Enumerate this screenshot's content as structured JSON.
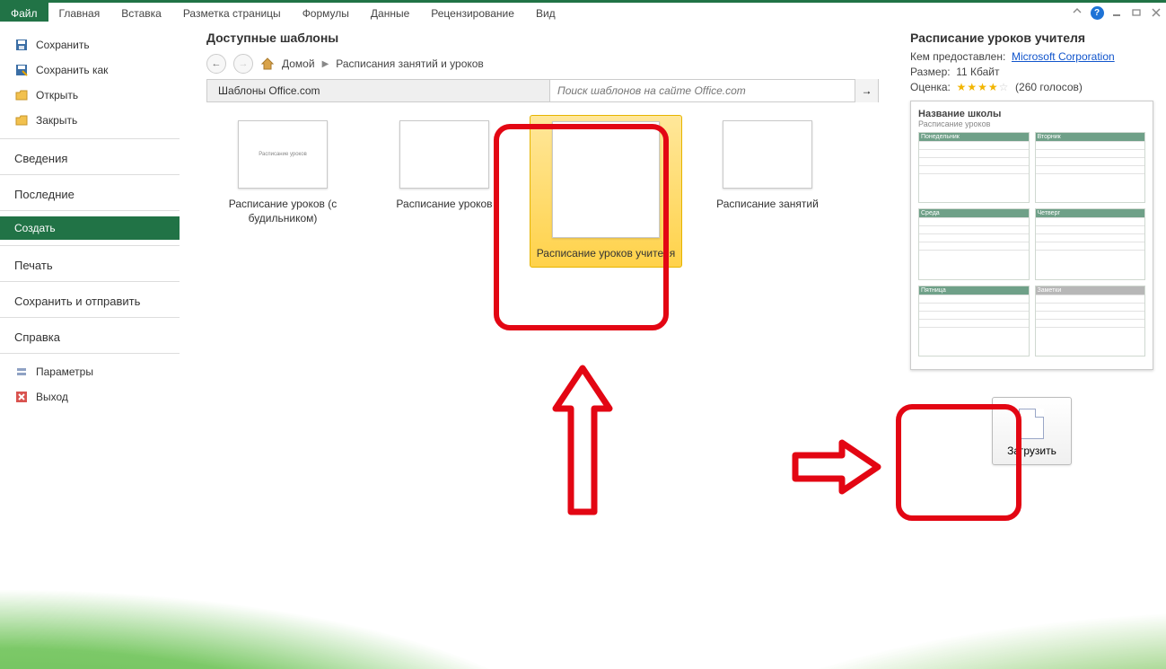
{
  "ribbon": {
    "tabs": [
      "Файл",
      "Главная",
      "Вставка",
      "Разметка страницы",
      "Формулы",
      "Данные",
      "Рецензирование",
      "Вид"
    ],
    "active_index": 0
  },
  "sidebar": {
    "items": [
      {
        "label": "Сохранить",
        "icon": "save"
      },
      {
        "label": "Сохранить как",
        "icon": "saveas"
      },
      {
        "label": "Открыть",
        "icon": "open"
      },
      {
        "label": "Закрыть",
        "icon": "close"
      }
    ],
    "sections": [
      "Сведения",
      "Последние",
      "Создать",
      "Печать",
      "Сохранить и отправить",
      "Справка"
    ],
    "selected_section": "Создать",
    "footer_items": [
      {
        "label": "Параметры",
        "icon": "options"
      },
      {
        "label": "Выход",
        "icon": "exit"
      }
    ]
  },
  "main": {
    "title": "Доступные шаблоны",
    "breadcrumb": {
      "home": "Домой",
      "current": "Расписания занятий и уроков"
    },
    "officecom_label": "Шаблоны Office.com",
    "search_placeholder": "Поиск шаблонов на сайте Office.com",
    "templates": [
      {
        "label": "Расписание уроков (с будильником)"
      },
      {
        "label": "Расписание уроков"
      },
      {
        "label": "Расписание уроков учителя",
        "selected": true
      },
      {
        "label": "Расписание занятий"
      }
    ]
  },
  "preview": {
    "title": "Расписание уроков учителя",
    "provided_by_label": "Кем предоставлен:",
    "provided_by_value": "Microsoft Corporation",
    "size_label": "Размер:",
    "size_value": "11 Кбайт",
    "rating_label": "Оценка:",
    "rating_stars": 4,
    "votes_text": "(260 голосов)",
    "mini": {
      "title": "Название школы",
      "sub": "Расписание уроков",
      "days": [
        "Понедельник",
        "Вторник",
        "Среда",
        "Четверг",
        "Пятница",
        "Заметки"
      ]
    },
    "download_label": "Загрузить"
  }
}
